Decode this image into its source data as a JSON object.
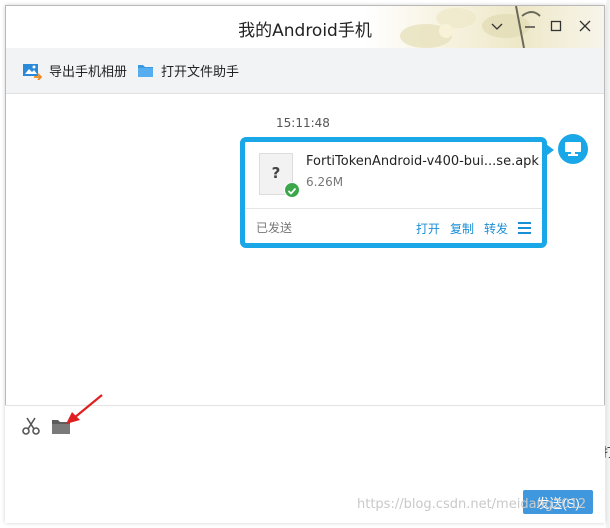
{
  "window": {
    "title": "我的Android手机"
  },
  "titlebar_buttons": {
    "down": "chevron-down-icon",
    "minimize": "minimize-icon",
    "maximize": "maximize-icon",
    "close": "close-icon"
  },
  "toolbar": {
    "export_album": "导出手机相册",
    "open_file_helper": "打开文件助手"
  },
  "chat": {
    "timestamp": "15:11:48",
    "message": {
      "file_name": "FortiTokenAndroid-v400-bui...se.apk",
      "file_size": "6.26M",
      "file_icon_glyph": "?",
      "status": "已发送",
      "actions": {
        "open": "打开",
        "copy": "复制",
        "forward": "转发"
      }
    }
  },
  "input": {
    "send_label": "发送(S)"
  },
  "watermark": "https://blog.csdn.net/meidang2012",
  "edge_char": "打",
  "colors": {
    "accent": "#1aa7e8",
    "link": "#1a8fd6",
    "send": "#3f97de",
    "success": "#3aa84a"
  }
}
